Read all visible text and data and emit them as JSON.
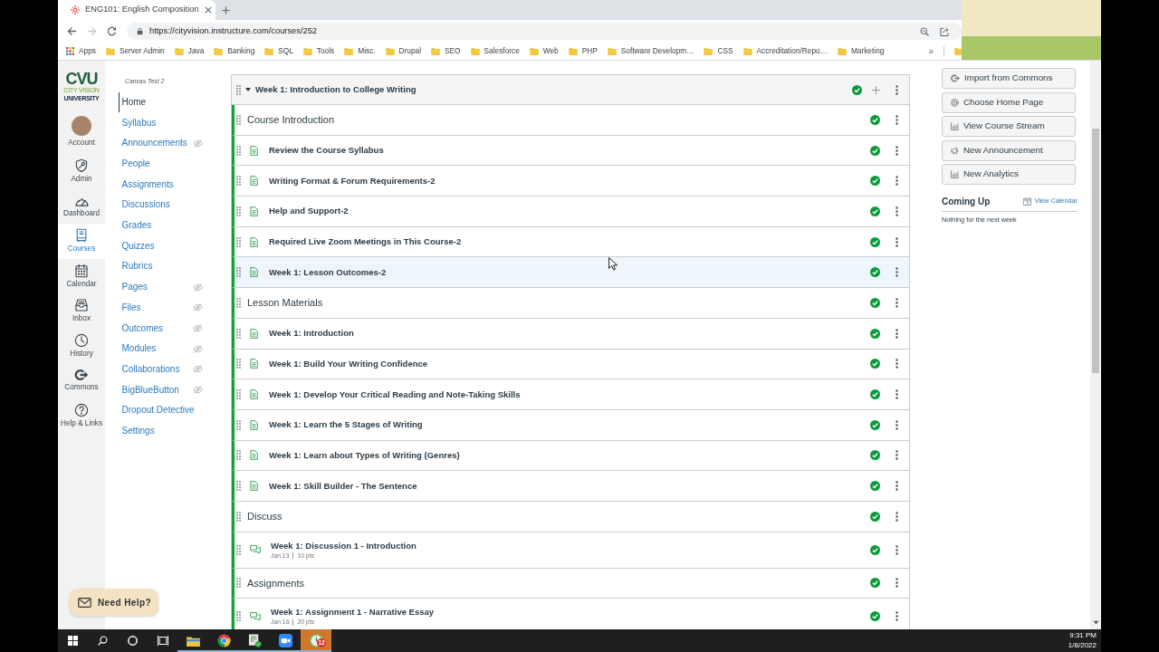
{
  "browser": {
    "tab_title": "ENG101: English Composition",
    "url": "https://cityvision.instructure.com/courses/252",
    "bookmarks": [
      {
        "kind": "apps",
        "label": "Apps"
      },
      {
        "kind": "folder",
        "label": "Server Admin"
      },
      {
        "kind": "folder",
        "label": "Java"
      },
      {
        "kind": "folder",
        "label": "Banking"
      },
      {
        "kind": "folder",
        "label": "SQL"
      },
      {
        "kind": "folder",
        "label": "Tools"
      },
      {
        "kind": "folder",
        "label": "Misc."
      },
      {
        "kind": "folder",
        "label": "Drupal"
      },
      {
        "kind": "folder",
        "label": "SEO"
      },
      {
        "kind": "folder",
        "label": "Salesforce"
      },
      {
        "kind": "folder",
        "label": "Web"
      },
      {
        "kind": "folder",
        "label": "PHP"
      },
      {
        "kind": "folder",
        "label": "Software Developm…"
      },
      {
        "kind": "folder",
        "label": "CSS"
      },
      {
        "kind": "folder",
        "label": "Accreditation/Repo…"
      },
      {
        "kind": "folder",
        "label": "Marketing"
      }
    ],
    "bookmarks_more": "»"
  },
  "global_nav": {
    "logo": {
      "mark": "CVU",
      "name_top": "CITY VISION",
      "name_bottom": "UNIVERSITY"
    },
    "items": [
      {
        "kind": "account",
        "label": "Account",
        "selected": false
      },
      {
        "kind": "admin",
        "label": "Admin",
        "selected": false
      },
      {
        "kind": "dashboard",
        "label": "Dashboard",
        "selected": false
      },
      {
        "kind": "courses",
        "label": "Courses",
        "selected": true
      },
      {
        "kind": "calendar",
        "label": "Calendar",
        "selected": false
      },
      {
        "kind": "inbox",
        "label": "Inbox",
        "selected": false
      },
      {
        "kind": "history",
        "label": "History",
        "selected": false
      },
      {
        "kind": "commons",
        "label": "Commons",
        "selected": false
      },
      {
        "kind": "help",
        "label": "Help & Links",
        "selected": false
      }
    ]
  },
  "course_nav": {
    "course_name": "Canvas Test 2",
    "items": [
      {
        "label": "Home",
        "selected": true,
        "hidden": false
      },
      {
        "label": "Syllabus",
        "selected": false,
        "hidden": false
      },
      {
        "label": "Announcements",
        "selected": false,
        "hidden": true
      },
      {
        "label": "People",
        "selected": false,
        "hidden": false
      },
      {
        "label": "Assignments",
        "selected": false,
        "hidden": false
      },
      {
        "label": "Discussions",
        "selected": false,
        "hidden": false
      },
      {
        "label": "Grades",
        "selected": false,
        "hidden": false
      },
      {
        "label": "Quizzes",
        "selected": false,
        "hidden": false
      },
      {
        "label": "Rubrics",
        "selected": false,
        "hidden": false
      },
      {
        "label": "Pages",
        "selected": false,
        "hidden": true
      },
      {
        "label": "Files",
        "selected": false,
        "hidden": true
      },
      {
        "label": "Outcomes",
        "selected": false,
        "hidden": true
      },
      {
        "label": "Modules",
        "selected": false,
        "hidden": true
      },
      {
        "label": "Collaborations",
        "selected": false,
        "hidden": true
      },
      {
        "label": "BigBlueButton",
        "selected": false,
        "hidden": true
      },
      {
        "label": "Dropout Detective",
        "selected": false,
        "hidden": false
      },
      {
        "label": "Settings",
        "selected": false,
        "hidden": false
      }
    ]
  },
  "module": {
    "title": "Week 1: Introduction to College Writing",
    "expanded": true,
    "published": true,
    "items": [
      {
        "kind": "header",
        "title": "Course Introduction",
        "published": true,
        "hovered": false
      },
      {
        "kind": "page",
        "title": "Review the Course Syllabus",
        "published": true,
        "hovered": false
      },
      {
        "kind": "page",
        "title": "Writing Format & Forum Requirements-2",
        "published": true,
        "hovered": false
      },
      {
        "kind": "page",
        "title": "Help and Support-2",
        "published": true,
        "hovered": false
      },
      {
        "kind": "page",
        "title": "Required Live Zoom Meetings in This Course-2",
        "published": true,
        "hovered": false
      },
      {
        "kind": "page",
        "title": "Week 1: Lesson Outcomes-2",
        "published": true,
        "hovered": true
      },
      {
        "kind": "header",
        "title": "Lesson Materials",
        "published": true,
        "hovered": false
      },
      {
        "kind": "page",
        "title": "Week 1: Introduction",
        "published": true,
        "hovered": false
      },
      {
        "kind": "page",
        "title": "Week 1: Build Your Writing Confidence",
        "published": true,
        "hovered": false
      },
      {
        "kind": "page",
        "title": "Week 1: Develop Your Critical Reading and Note-Taking Skills",
        "published": true,
        "hovered": false
      },
      {
        "kind": "page",
        "title": "Week 1: Learn the 5 Stages of Writing",
        "published": true,
        "hovered": false
      },
      {
        "kind": "page",
        "title": "Week 1: Learn about Types of Writing (Genres)",
        "published": true,
        "hovered": false
      },
      {
        "kind": "page",
        "title": "Week 1: Skill Builder - The Sentence",
        "published": true,
        "hovered": false
      },
      {
        "kind": "header",
        "title": "Discuss",
        "published": true,
        "hovered": false
      },
      {
        "kind": "discussion",
        "title": "Week 1: Discussion 1 - Introduction",
        "due": "Jan 13",
        "points": "10 pts",
        "published": true,
        "hovered": false
      },
      {
        "kind": "header",
        "title": "Assignments",
        "published": true,
        "hovered": false
      },
      {
        "kind": "discussion",
        "title": "Week 1: Assignment 1 - Narrative Essay",
        "due": "Jan 16",
        "points": "20 pts",
        "published": true,
        "hovered": false
      }
    ]
  },
  "sidebar": {
    "buttons": [
      {
        "kind": "commons",
        "label": "Import from Commons"
      },
      {
        "kind": "home-page",
        "label": "Choose Home Page"
      },
      {
        "kind": "stream",
        "label": "View Course Stream"
      },
      {
        "kind": "announcement",
        "label": "New Announcement"
      },
      {
        "kind": "analytics",
        "label": "New Analytics"
      }
    ],
    "coming_up": {
      "title": "Coming Up",
      "link": "View Calendar",
      "message": "Nothing for the next week"
    }
  },
  "help_button": {
    "label": "Need Help?"
  },
  "taskbar": {
    "apps": [
      {
        "kind": "explorer",
        "running": true,
        "flashing": false
      },
      {
        "kind": "browser",
        "running": true,
        "flashing": false
      },
      {
        "kind": "tasks",
        "running": true,
        "flashing": false
      },
      {
        "kind": "video",
        "running": true,
        "flashing": false
      },
      {
        "kind": "clock",
        "running": true,
        "flashing": true,
        "badge": "12"
      }
    ],
    "time": "9:31 PM",
    "date": "1/8/2022"
  }
}
